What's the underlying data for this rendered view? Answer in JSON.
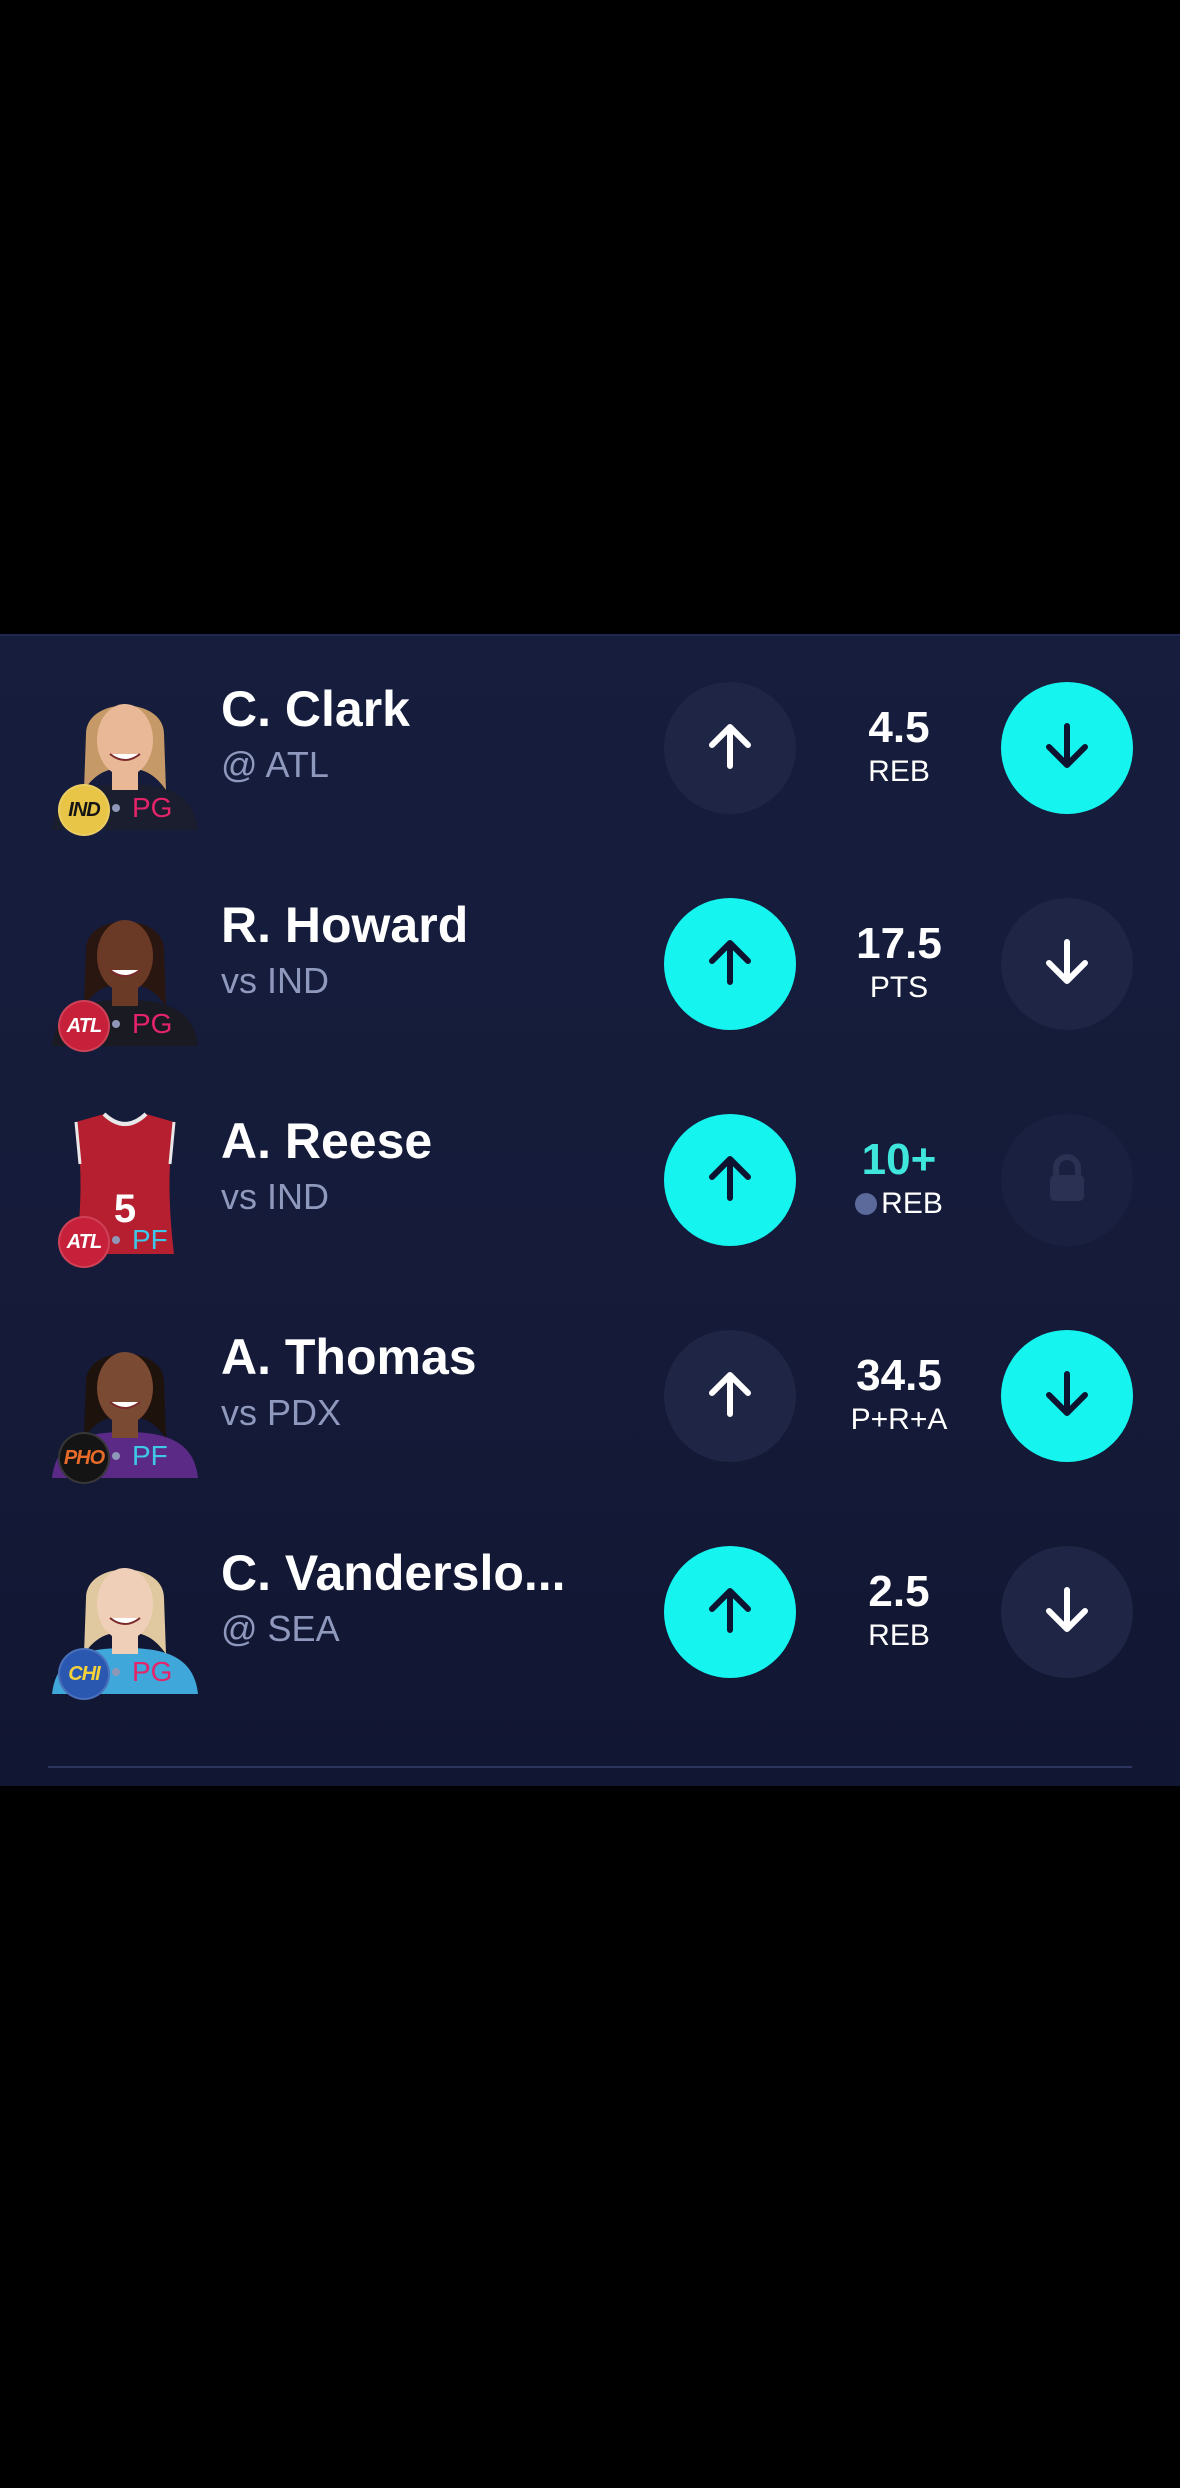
{
  "rows": [
    {
      "name": "C. Clark",
      "opponent": "@ ATL",
      "team": "IND",
      "position": "PG",
      "line": "4.5",
      "stat": "REB",
      "selected": "down",
      "boosted": false,
      "locked": false,
      "teamColor": "#e8c547",
      "teamText": "#141414",
      "posColor": "#e4246a",
      "skin": "#e8b897",
      "hair": "#c59a68",
      "jersey": "#1b1e2e",
      "avatar": "player-headshot"
    },
    {
      "name": "R. Howard",
      "opponent": "vs IND",
      "team": "ATL",
      "position": "PG",
      "line": "17.5",
      "stat": "PTS",
      "selected": "up",
      "boosted": false,
      "locked": false,
      "teamColor": "#c7203a",
      "teamText": "#ffffff",
      "posColor": "#e4246a",
      "skin": "#6b3a26",
      "hair": "#2a1610",
      "jersey": "#1a1a22",
      "avatar": "player-headshot"
    },
    {
      "name": "A. Reese",
      "opponent": "vs IND",
      "team": "ATL",
      "position": "PF",
      "line": "10+",
      "stat": "REB",
      "selected": "up",
      "boosted": true,
      "locked": true,
      "teamColor": "#c7203a",
      "teamText": "#ffffff",
      "posColor": "#3ec7e6",
      "jerseyNumber": "5",
      "avatar": "jersey"
    },
    {
      "name": "A. Thomas",
      "opponent": "vs PDX",
      "team": "PHO",
      "position": "PF",
      "line": "34.5",
      "stat": "P+R+A",
      "selected": "down",
      "boosted": false,
      "locked": false,
      "teamColor": "#141414",
      "teamText": "#e86b2a",
      "posColor": "#3ec7e6",
      "skin": "#7a4a33",
      "hair": "#1e120c",
      "jersey": "#5a2a86",
      "avatar": "player-headshot"
    },
    {
      "name": "C. Vanderslo...",
      "opponent": "@ SEA",
      "team": "CHI",
      "position": "PG",
      "line": "2.5",
      "stat": "REB",
      "selected": "up",
      "boosted": false,
      "locked": false,
      "teamColor": "#2a58b0",
      "teamText": "#f5d23a",
      "posColor": "#e4246a",
      "skin": "#efcfb8",
      "hair": "#e0c8a0",
      "jersey": "#3fa7d9",
      "avatar": "player-headshot"
    }
  ],
  "icons": {
    "up": "arrow-up-icon",
    "down": "arrow-down-icon",
    "lock": "lock-icon",
    "boost": "boost-icon"
  },
  "colors": {
    "accent": "#16f4ef",
    "panel": "#161d3d"
  }
}
